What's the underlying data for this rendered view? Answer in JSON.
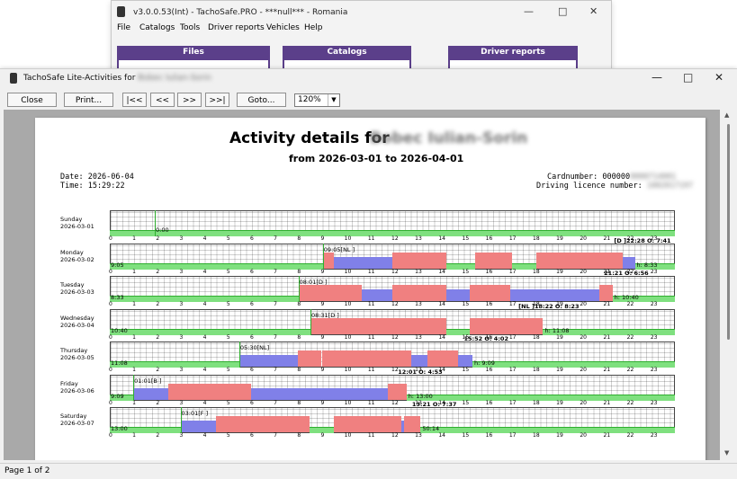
{
  "main_window": {
    "title": "v3.0.0.53(Int) - TachoSafe.PRO - ***null*** - Romania",
    "menu": [
      "File",
      "Catalogs",
      "Tools",
      "Driver reports",
      "Vehicles",
      "Help"
    ],
    "panels": [
      "Files",
      "Catalogs",
      "Driver reports"
    ]
  },
  "window": {
    "title_prefix": "TachoSafe Lite-Activities for",
    "title_driver": "Bobec Iulian-Sorin"
  },
  "toolbar": {
    "close": "Close",
    "print": "Print...",
    "first": "|<<",
    "prev": "<<",
    "next": ">>",
    "last": ">>|",
    "goto": "Goto...",
    "zoom": "120%"
  },
  "status": {
    "page": "Page 1 of 2"
  },
  "report": {
    "title": "Activity details for",
    "driver": "Bobec Iulian-Sorin",
    "range": "from 2026-03-01 to 2026-04-01",
    "date": "Date: 2026-06-04",
    "time": "Time: 15:29:22",
    "cardnumber_label": "Cardnumber: 000000",
    "cardnumber_hidden": "0000714001",
    "licence_label": "Driving licence number:",
    "licence_hidden": "1002017197"
  },
  "days": [
    {
      "name": "Sunday",
      "date": "2026-03-01",
      "start_note": "0:00",
      "segments": [
        {
          "from": 0,
          "to": 24,
          "type": "rest"
        }
      ],
      "top_note": "",
      "left_total": "",
      "right_total": ""
    },
    {
      "name": "Monday",
      "date": "2026-03-02",
      "start_note": "09:05[NL ]",
      "segments": [
        {
          "from": 0,
          "to": 9.05,
          "type": "rest"
        },
        {
          "from": 9.05,
          "to": 9.5,
          "type": "drive"
        },
        {
          "from": 9.5,
          "to": 10.5,
          "type": "work"
        },
        {
          "from": 10.5,
          "to": 12.0,
          "type": "work"
        },
        {
          "from": 12.0,
          "to": 12.7,
          "type": "drive"
        },
        {
          "from": 12.7,
          "to": 14.3,
          "type": "drive"
        },
        {
          "from": 14.3,
          "to": 15.5,
          "type": "rest"
        },
        {
          "from": 15.5,
          "to": 17.1,
          "type": "drive"
        },
        {
          "from": 17.1,
          "to": 18.1,
          "type": "rest"
        },
        {
          "from": 18.1,
          "to": 21.8,
          "type": "drive"
        },
        {
          "from": 21.8,
          "to": 22.3,
          "type": "work"
        },
        {
          "from": 22.3,
          "to": 24,
          "type": "rest"
        }
      ],
      "top_note": "[D ]22:28 O: 7:41",
      "left_total": "9:05",
      "right_total": "h: 8:33"
    },
    {
      "name": "Tuesday",
      "date": "2026-03-03",
      "start_note": "08:01[D ]",
      "segments": [
        {
          "from": 0,
          "to": 8.01,
          "type": "rest"
        },
        {
          "from": 8.01,
          "to": 10.7,
          "type": "drive"
        },
        {
          "from": 10.7,
          "to": 12.0,
          "type": "work"
        },
        {
          "from": 12.0,
          "to": 14.3,
          "type": "drive"
        },
        {
          "from": 14.3,
          "to": 15.3,
          "type": "work"
        },
        {
          "from": 15.3,
          "to": 17.0,
          "type": "drive"
        },
        {
          "from": 17.0,
          "to": 20.8,
          "type": "work"
        },
        {
          "from": 20.8,
          "to": 21.35,
          "type": "drive"
        },
        {
          "from": 21.35,
          "to": 24,
          "type": "rest"
        }
      ],
      "top_note": "21:21 O: 6:56",
      "left_total": "8:33",
      "right_total": "h: 10:40"
    },
    {
      "name": "Wednesday",
      "date": "2026-03-04",
      "start_note": "08:31[D ]",
      "segments": [
        {
          "from": 0,
          "to": 8.52,
          "type": "rest"
        },
        {
          "from": 8.52,
          "to": 14.3,
          "type": "drive"
        },
        {
          "from": 14.3,
          "to": 15.3,
          "type": "rest"
        },
        {
          "from": 15.3,
          "to": 18.4,
          "type": "drive"
        },
        {
          "from": 18.4,
          "to": 24,
          "type": "rest"
        }
      ],
      "top_note": "[NL ]18:22 O: 8:23",
      "left_total": "10:40",
      "right_total": "h: 11:08"
    },
    {
      "name": "Thursday",
      "date": "2026-03-05",
      "start_note": "05:30[NL]",
      "segments": [
        {
          "from": 0,
          "to": 5.5,
          "type": "rest"
        },
        {
          "from": 5.5,
          "to": 8.0,
          "type": "work"
        },
        {
          "from": 8.0,
          "to": 9.0,
          "type": "drive"
        },
        {
          "from": 9.0,
          "to": 10.1,
          "type": "drive"
        },
        {
          "from": 10.1,
          "to": 12.8,
          "type": "drive"
        },
        {
          "from": 12.8,
          "to": 13.5,
          "type": "work"
        },
        {
          "from": 13.5,
          "to": 14.8,
          "type": "drive"
        },
        {
          "from": 14.8,
          "to": 15.4,
          "type": "work"
        },
        {
          "from": 15.4,
          "to": 24,
          "type": "rest"
        }
      ],
      "top_note": "15:52 O: 4:02",
      "left_total": "11:08",
      "right_total": "h: 9:09"
    },
    {
      "name": "Friday",
      "date": "2026-03-06",
      "start_note": "01:01[B ]",
      "segments": [
        {
          "from": 0,
          "to": 1.0,
          "type": "rest"
        },
        {
          "from": 1.0,
          "to": 2.5,
          "type": "work"
        },
        {
          "from": 2.5,
          "to": 6.0,
          "type": "drive"
        },
        {
          "from": 6.0,
          "to": 11.8,
          "type": "work"
        },
        {
          "from": 11.8,
          "to": 12.6,
          "type": "drive"
        },
        {
          "from": 12.6,
          "to": 24,
          "type": "rest"
        }
      ],
      "top_note": "12:01 O: 4:53",
      "left_total": "9:09",
      "right_total": "h: 13:00"
    },
    {
      "name": "Saturday",
      "date": "2026-03-07",
      "start_note": "03:01[F ]",
      "segments": [
        {
          "from": 0,
          "to": 3.0,
          "type": "rest"
        },
        {
          "from": 3.0,
          "to": 4.5,
          "type": "work"
        },
        {
          "from": 4.5,
          "to": 8.5,
          "type": "drive"
        },
        {
          "from": 8.5,
          "to": 9.5,
          "type": "rest"
        },
        {
          "from": 9.5,
          "to": 12.4,
          "type": "drive"
        },
        {
          "from": 12.4,
          "to": 12.5,
          "type": "work"
        },
        {
          "from": 12.5,
          "to": 13.2,
          "type": "drive"
        },
        {
          "from": 13.2,
          "to": 24,
          "type": "rest"
        }
      ],
      "top_note": "13:21 O: 7:37",
      "left_total": "13:00",
      "right_total": "50:14"
    }
  ],
  "hours": [
    "0",
    "1",
    "2",
    "3",
    "4",
    "5",
    "6",
    "7",
    "8",
    "9",
    "10",
    "11",
    "12",
    "13",
    "14",
    "15",
    "16",
    "17",
    "18",
    "19",
    "20",
    "21",
    "22",
    "23"
  ],
  "colors": {
    "drive": "#f08080",
    "work": "#8080e8",
    "rest": "#7fe07f",
    "restline": "#2fae2f",
    "panel": "#5b3f8a"
  }
}
